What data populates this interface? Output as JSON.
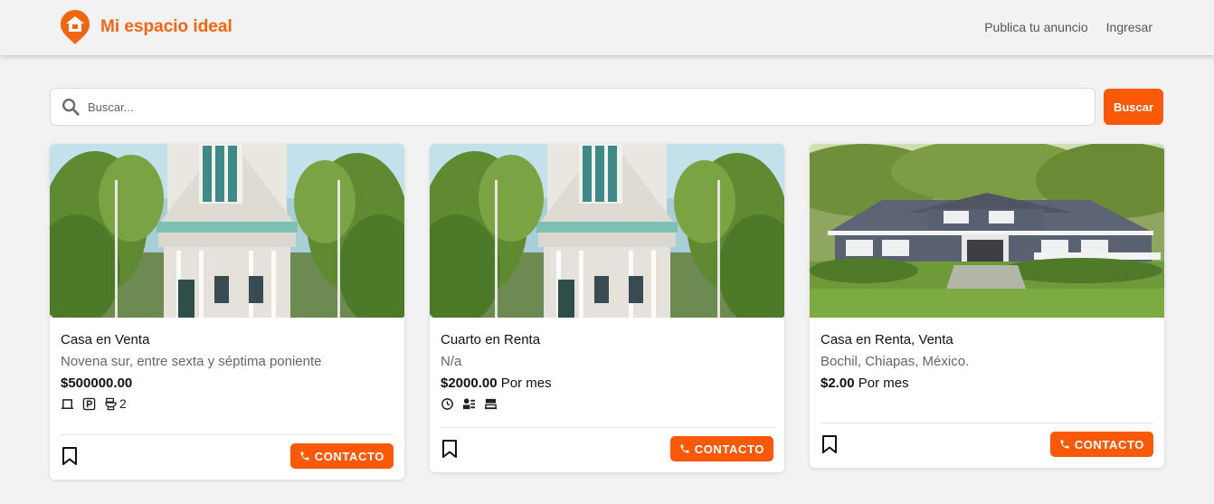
{
  "brand": {
    "name": "Mi espacio ideal",
    "color": "#f26511"
  },
  "nav": {
    "publish": "Publica tu anuncio",
    "login": "Ingresar"
  },
  "search": {
    "placeholder": "Buscar...",
    "button": "Buscar",
    "icon": "search-icon"
  },
  "accent": "#fa5a08",
  "cards": [
    {
      "title": "Casa en Venta",
      "address": "Novena sur, entre sexta y séptima poniente",
      "price": "$500000.00",
      "period": "",
      "amenities": [
        {
          "icon": "bed-icon",
          "value": ""
        },
        {
          "icon": "parking-icon",
          "value": ""
        },
        {
          "icon": "toilet-icon",
          "value": "2"
        }
      ],
      "contact": "CONTACTO"
    },
    {
      "title": "Cuarto en Renta",
      "address": "N/a",
      "price": "$2000.00",
      "period": "Por mes",
      "amenities": [
        {
          "icon": "clock-icon",
          "value": ""
        },
        {
          "icon": "services-icon",
          "value": ""
        },
        {
          "icon": "furniture-icon",
          "value": ""
        }
      ],
      "contact": "CONTACTO"
    },
    {
      "title": "Casa en Renta, Venta",
      "address": "Bochil, Chiapas, México.",
      "price": "$2.00",
      "period": "Por mes",
      "amenities": [],
      "contact": "CONTACTO"
    }
  ]
}
